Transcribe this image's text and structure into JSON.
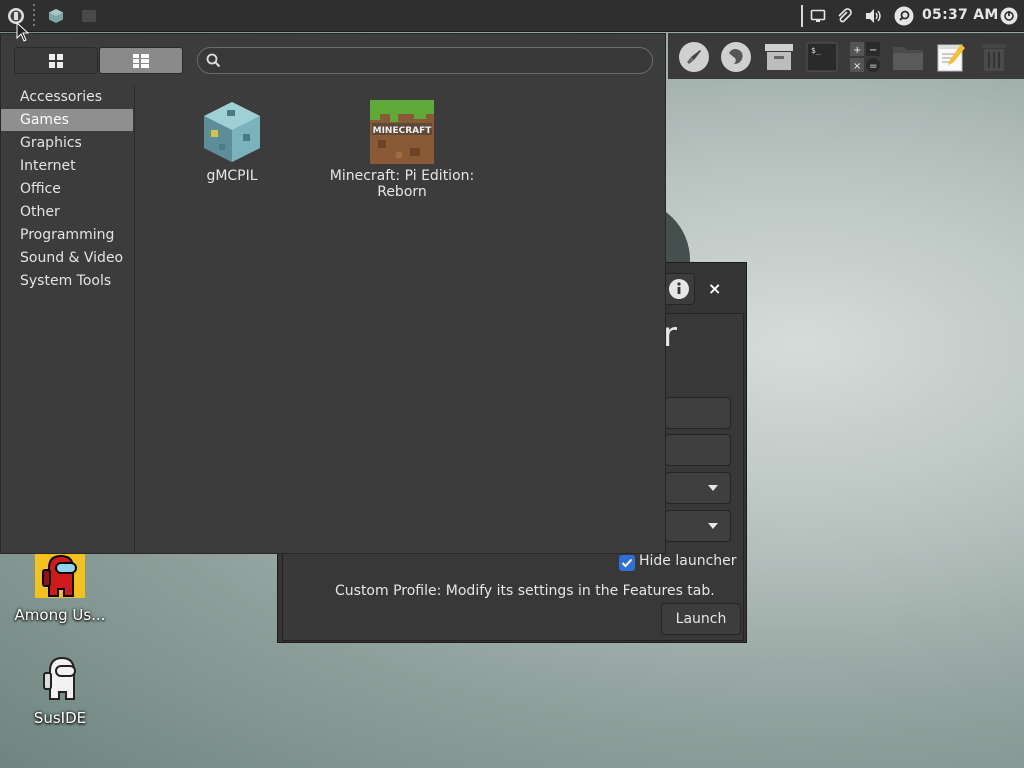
{
  "top_panel": {
    "clock": "05:37 AM"
  },
  "launcher_window": {
    "title_fragment": "r",
    "close_glyph": "×",
    "hide_launcher_label": "Hide launcher",
    "hide_launcher_checked": true,
    "profile_text": "Custom Profile: Modify its settings in the Features tab.",
    "launch_label": "Launch"
  },
  "app_menu": {
    "search": {
      "placeholder": "",
      "value": ""
    },
    "categories": [
      {
        "label": "Accessories",
        "selected": false
      },
      {
        "label": "Games",
        "selected": true
      },
      {
        "label": "Graphics",
        "selected": false
      },
      {
        "label": "Internet",
        "selected": false
      },
      {
        "label": "Office",
        "selected": false
      },
      {
        "label": "Other",
        "selected": false
      },
      {
        "label": "Programming",
        "selected": false
      },
      {
        "label": "Sound & Video",
        "selected": false
      },
      {
        "label": "System Tools",
        "selected": false
      }
    ],
    "apps": [
      {
        "label": "gMCPIL",
        "icon": "gmcpil-cube-icon"
      },
      {
        "label_line1": "Minecraft: Pi Edition:",
        "label_line2": "Reborn",
        "icon": "minecraft-grass-block-icon",
        "icon_text": "MINECRAFT"
      }
    ]
  },
  "desktop": {
    "icons": [
      {
        "label": "Among Us...",
        "icon": "among-us-icon"
      },
      {
        "label": "SusIDE",
        "icon": "suside-icon"
      }
    ]
  },
  "colors": {
    "accent": "#2d6fd3",
    "panel": "#2f2f2f",
    "menu_bg": "#3c3c3c",
    "selection": "#8f8f8f"
  }
}
